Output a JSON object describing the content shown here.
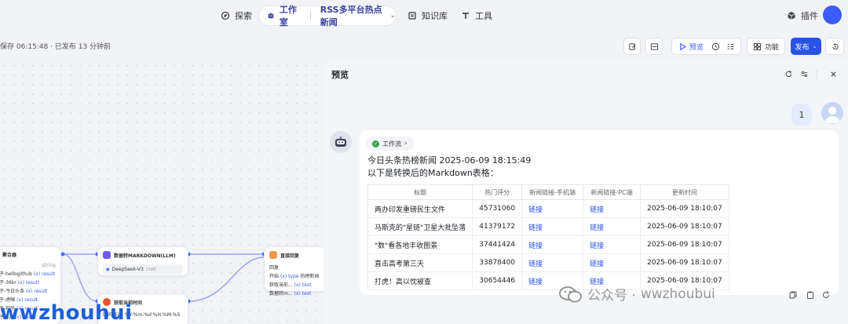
{
  "nav": {
    "search": "探索",
    "workspace": "工作室",
    "project": "RSS多平台热点新闻",
    "knowledge": "知识库",
    "tools": "工具",
    "plugins": "插件"
  },
  "toolbar": {
    "save_status": "保存 06:15:48 · 已发布 13 分钟前",
    "preview": "预览",
    "features": "功能",
    "publish": "发布"
  },
  "canvas": {
    "node_aggregate": {
      "title": "聚合器",
      "type": "string",
      "rows": [
        {
          "src": "子-hellogithub",
          "var": "(x) result"
        },
        {
          "src": "子-36kr",
          "var": "(x) result"
        },
        {
          "src": "子-今日头条",
          "var": "(x) result"
        },
        {
          "src": "子-虎嗅",
          "var": "(x) result"
        },
        {
          "src": "子-知乎",
          "var": "(x) result"
        },
        {
          "src": "子-B站",
          "var": "(x) result"
        }
      ]
    },
    "node_llm": {
      "title": "数据转MARKDOWN(LLM)",
      "model": "DeepSeek-V3",
      "mode": "CHAT"
    },
    "node_time": {
      "title": "获取当前时间",
      "fmt_label": "时间格式",
      "fmt": "%Y-%m-%d %H:%M:%S"
    },
    "node_answer": {
      "title": "直接回复",
      "label": "回复",
      "rows": [
        {
          "src": "开始",
          "var": "(x) type",
          "extra": "热榜新闻"
        },
        {
          "src": "获取当前...",
          "var": "(x) text"
        },
        {
          "src": "数据转m...",
          "var": "(x) text"
        }
      ]
    }
  },
  "preview": {
    "title": "预览",
    "user_message": "1",
    "workflow_chip": "工作流",
    "headline": "今日头条热榜新闻 2025-06-09 18:15:49",
    "intro": "以下是转换后的Markdown表格：",
    "table": {
      "headers": [
        "标题",
        "热门评分",
        "新闻链接-手机端",
        "新闻链接-PC端",
        "更新时间"
      ],
      "rows": [
        [
          "两办印发重磅民生文件",
          "45731060",
          "链接",
          "链接",
          "2025-06-09 18:10:07"
        ],
        [
          "马斯克的\"星链\"卫星大批坠落",
          "41379172",
          "链接",
          "链接",
          "2025-06-09 18:10:07"
        ],
        [
          "\"数\"看各地丰收图景",
          "37441424",
          "链接",
          "链接",
          "2025-06-09 18:10:07"
        ],
        [
          "直击高考第三天",
          "33878400",
          "链接",
          "链接",
          "2025-06-09 18:10:07"
        ],
        [
          "打虎！高以忱被查",
          "30654446",
          "链接",
          "链接",
          "2025-06-09 18:10:07"
        ]
      ]
    }
  },
  "watermark": {
    "left": "wwzhouhui",
    "right_prefix": "公众号 · ",
    "right_name": "wwzhoubui"
  },
  "colors": {
    "accent": "#2a53e6",
    "llm_icon": "#6f5af2",
    "answer_icon": "#f2994a",
    "time_icon": "#e0562a",
    "ok": "#2fa84f"
  }
}
